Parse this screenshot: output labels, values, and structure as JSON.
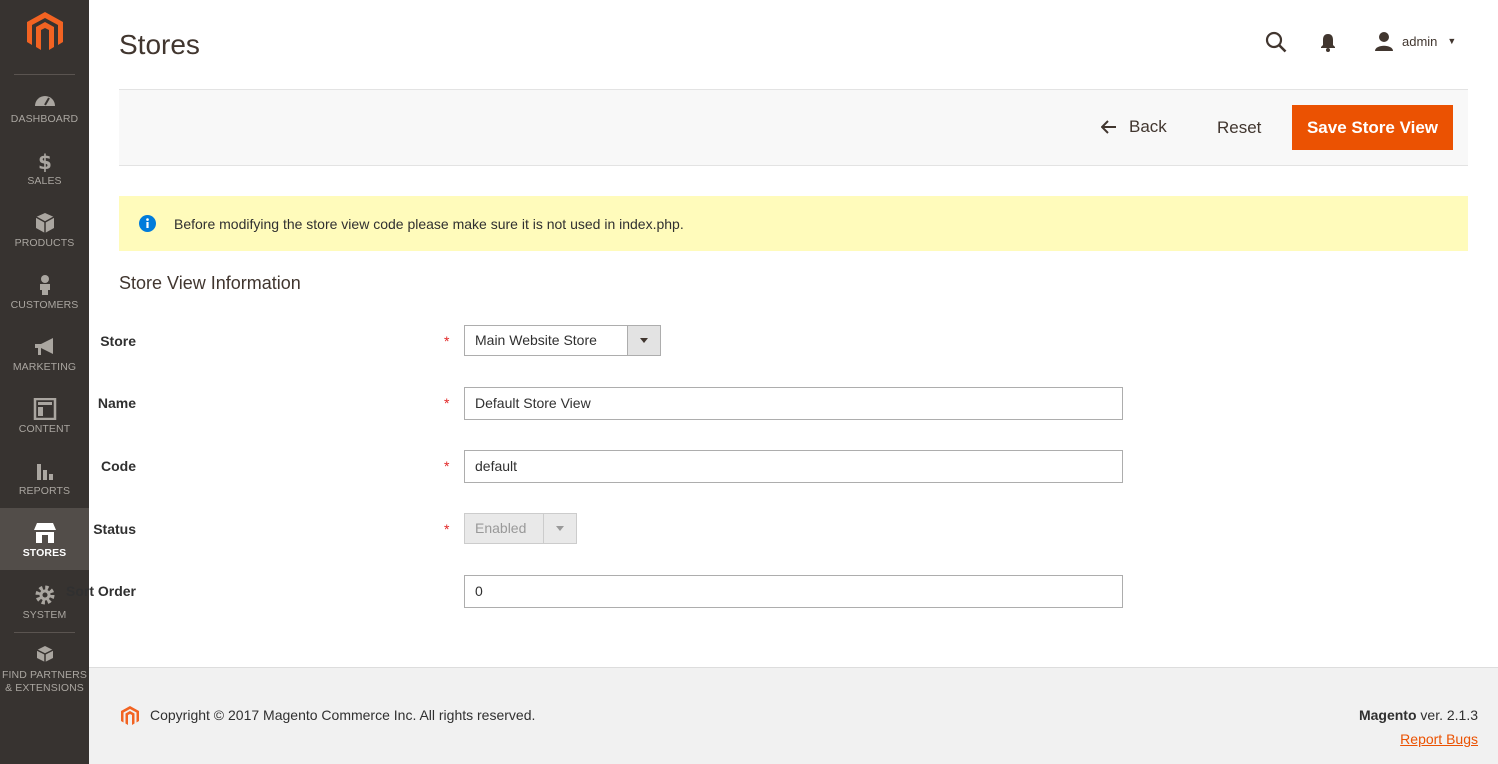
{
  "sidebar": {
    "logo_icon": "magento-logo",
    "items": [
      {
        "label": "DASHBOARD",
        "icon": "dashboard-icon"
      },
      {
        "label": "SALES",
        "icon": "dollar-icon"
      },
      {
        "label": "PRODUCTS",
        "icon": "box-icon"
      },
      {
        "label": "CUSTOMERS",
        "icon": "person-icon"
      },
      {
        "label": "MARKETING",
        "icon": "megaphone-icon"
      },
      {
        "label": "CONTENT",
        "icon": "layout-icon"
      },
      {
        "label": "REPORTS",
        "icon": "bar-chart-icon"
      },
      {
        "label": "STORES",
        "icon": "storefront-icon",
        "active": true
      },
      {
        "label": "SYSTEM",
        "icon": "gear-icon"
      }
    ],
    "extensions": {
      "line1": "FIND PARTNERS",
      "line2": "& EXTENSIONS",
      "icon": "blocks-icon"
    }
  },
  "header": {
    "title": "Stores",
    "user": "admin"
  },
  "actions": {
    "back": "Back",
    "reset": "Reset",
    "save": "Save Store View"
  },
  "message": {
    "text": "Before modifying the store view code please make sure it is not used in index.php."
  },
  "form": {
    "section_title": "Store View Information",
    "store": {
      "label": "Store",
      "value": "Main Website Store"
    },
    "name": {
      "label": "Name",
      "value": "Default Store View"
    },
    "code": {
      "label": "Code",
      "value": "default"
    },
    "status": {
      "label": "Status",
      "value": "Enabled"
    },
    "sort_order": {
      "label": "Sort Order",
      "value": "0"
    },
    "required_mark": "*"
  },
  "footer": {
    "copyright": "Copyright © 2017 Magento Commerce Inc. All rights reserved.",
    "brand": "Magento",
    "version": " ver. 2.1.3",
    "report_bugs": "Report Bugs"
  },
  "colors": {
    "sidebar_bg": "#373330",
    "accent": "#eb5202",
    "message_bg": "#fffbbb"
  }
}
